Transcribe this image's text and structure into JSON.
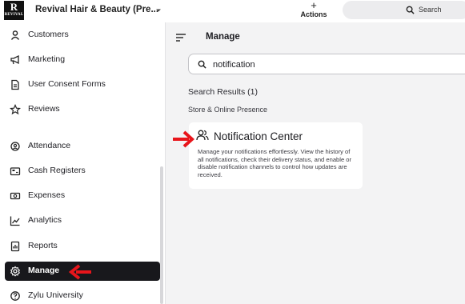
{
  "topbar": {
    "logo_letter": "R",
    "logo_text": "REVIVAL",
    "store_name": "Revival Hair & Beauty (Pre...",
    "actions_symbol": "+",
    "actions_label": "Actions",
    "search_placeholder": "Search"
  },
  "sidebar": {
    "items": [
      {
        "label": "Customers",
        "icon": "customers-icon"
      },
      {
        "label": "Marketing",
        "icon": "megaphone-icon"
      },
      {
        "label": "User Consent Forms",
        "icon": "document-icon"
      },
      {
        "label": "Reviews",
        "icon": "star-icon"
      },
      {
        "label": "Attendance",
        "icon": "attendance-icon"
      },
      {
        "label": "Cash Registers",
        "icon": "cash-register-icon"
      },
      {
        "label": "Expenses",
        "icon": "cash-icon"
      },
      {
        "label": "Analytics",
        "icon": "chart-icon"
      },
      {
        "label": "Reports",
        "icon": "report-icon"
      },
      {
        "label": "Manage",
        "icon": "gear-icon",
        "active": true
      },
      {
        "label": "Zylu University",
        "icon": "help-icon"
      }
    ]
  },
  "main": {
    "title": "Manage",
    "search_value": "notification",
    "results_label": "Search Results (1)",
    "category": "Store & Online Presence",
    "card": {
      "title": "Notification Center",
      "icon": "users-icon",
      "description": "Manage your notifications effortlessly. View the history of all notifications, check their delivery status, and enable or disable notification channels to control how updates are received."
    }
  },
  "colors": {
    "accent_dark": "#18181c",
    "annotation_red": "#e8151b",
    "background": "#f3f3f4"
  }
}
